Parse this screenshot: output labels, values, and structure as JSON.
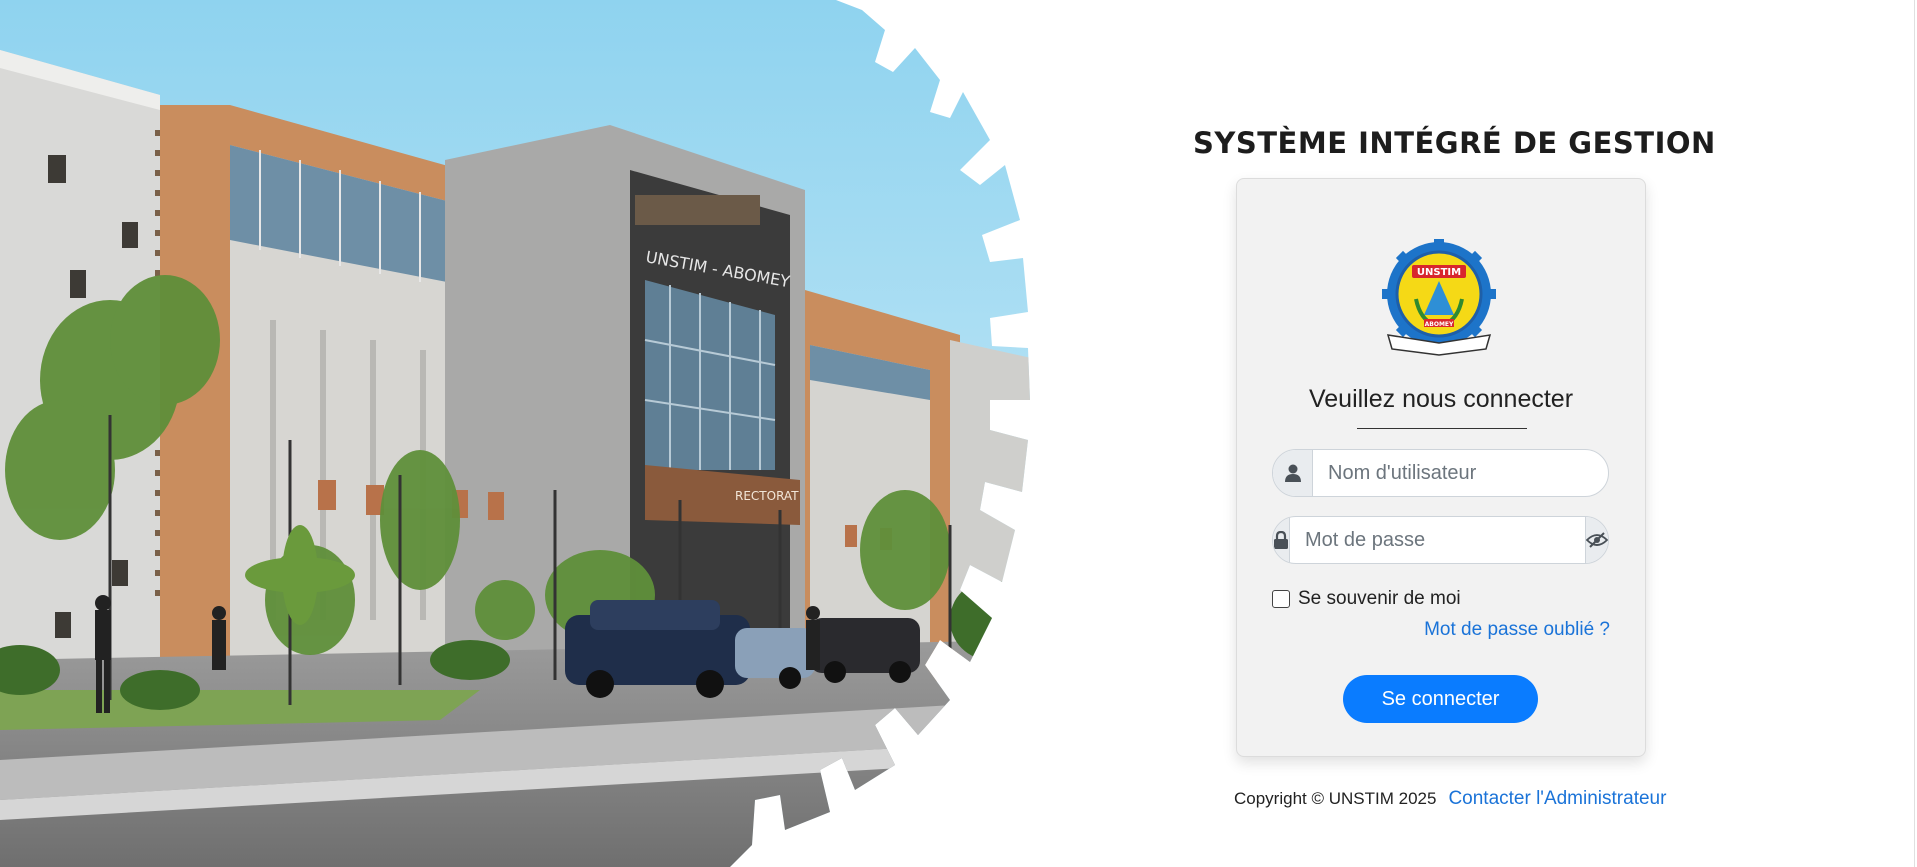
{
  "app": {
    "title": "SYSTÈME INTÉGRÉ DE GESTION"
  },
  "hero": {
    "building_sign": "UNSTIM - ABOMEY",
    "entrance_sign": "RECTORAT"
  },
  "login": {
    "heading": "Veuillez nous connecter",
    "username_placeholder": "Nom d'utilisateur",
    "password_placeholder": "Mot de passe",
    "remember_label": "Se souvenir de moi",
    "forgot_link": "Mot de passe oublié ?",
    "submit_label": "Se connecter"
  },
  "logo": {
    "acronym": "UNSTIM",
    "city": "ABOMEY"
  },
  "footer": {
    "copyright": "Copyright © UNSTIM 2025",
    "contact_link": "Contacter l'Administrateur"
  },
  "colors": {
    "accent": "#0a7cff",
    "link": "#1a73d8",
    "card_bg": "#f2f2f2",
    "facade_orange": "#c98d5e"
  },
  "icons": {
    "user": "user-icon",
    "lock": "lock-icon",
    "toggle_password": "eye-slash-icon"
  }
}
